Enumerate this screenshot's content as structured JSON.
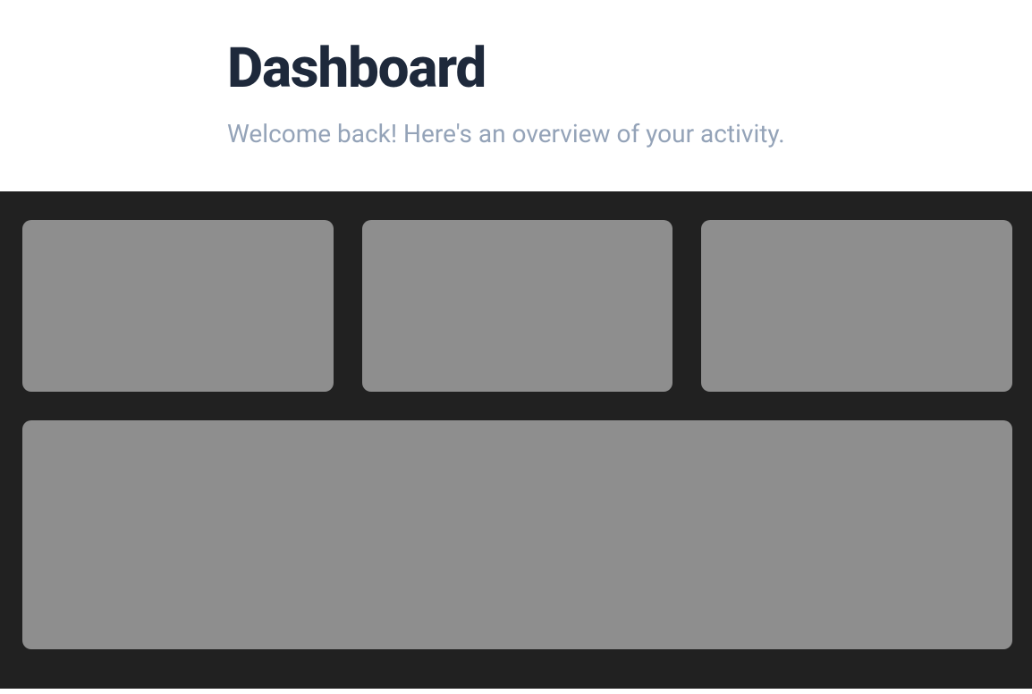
{
  "header": {
    "title": "Dashboard",
    "subtitle": "Welcome back! Here's an overview of your activity."
  }
}
